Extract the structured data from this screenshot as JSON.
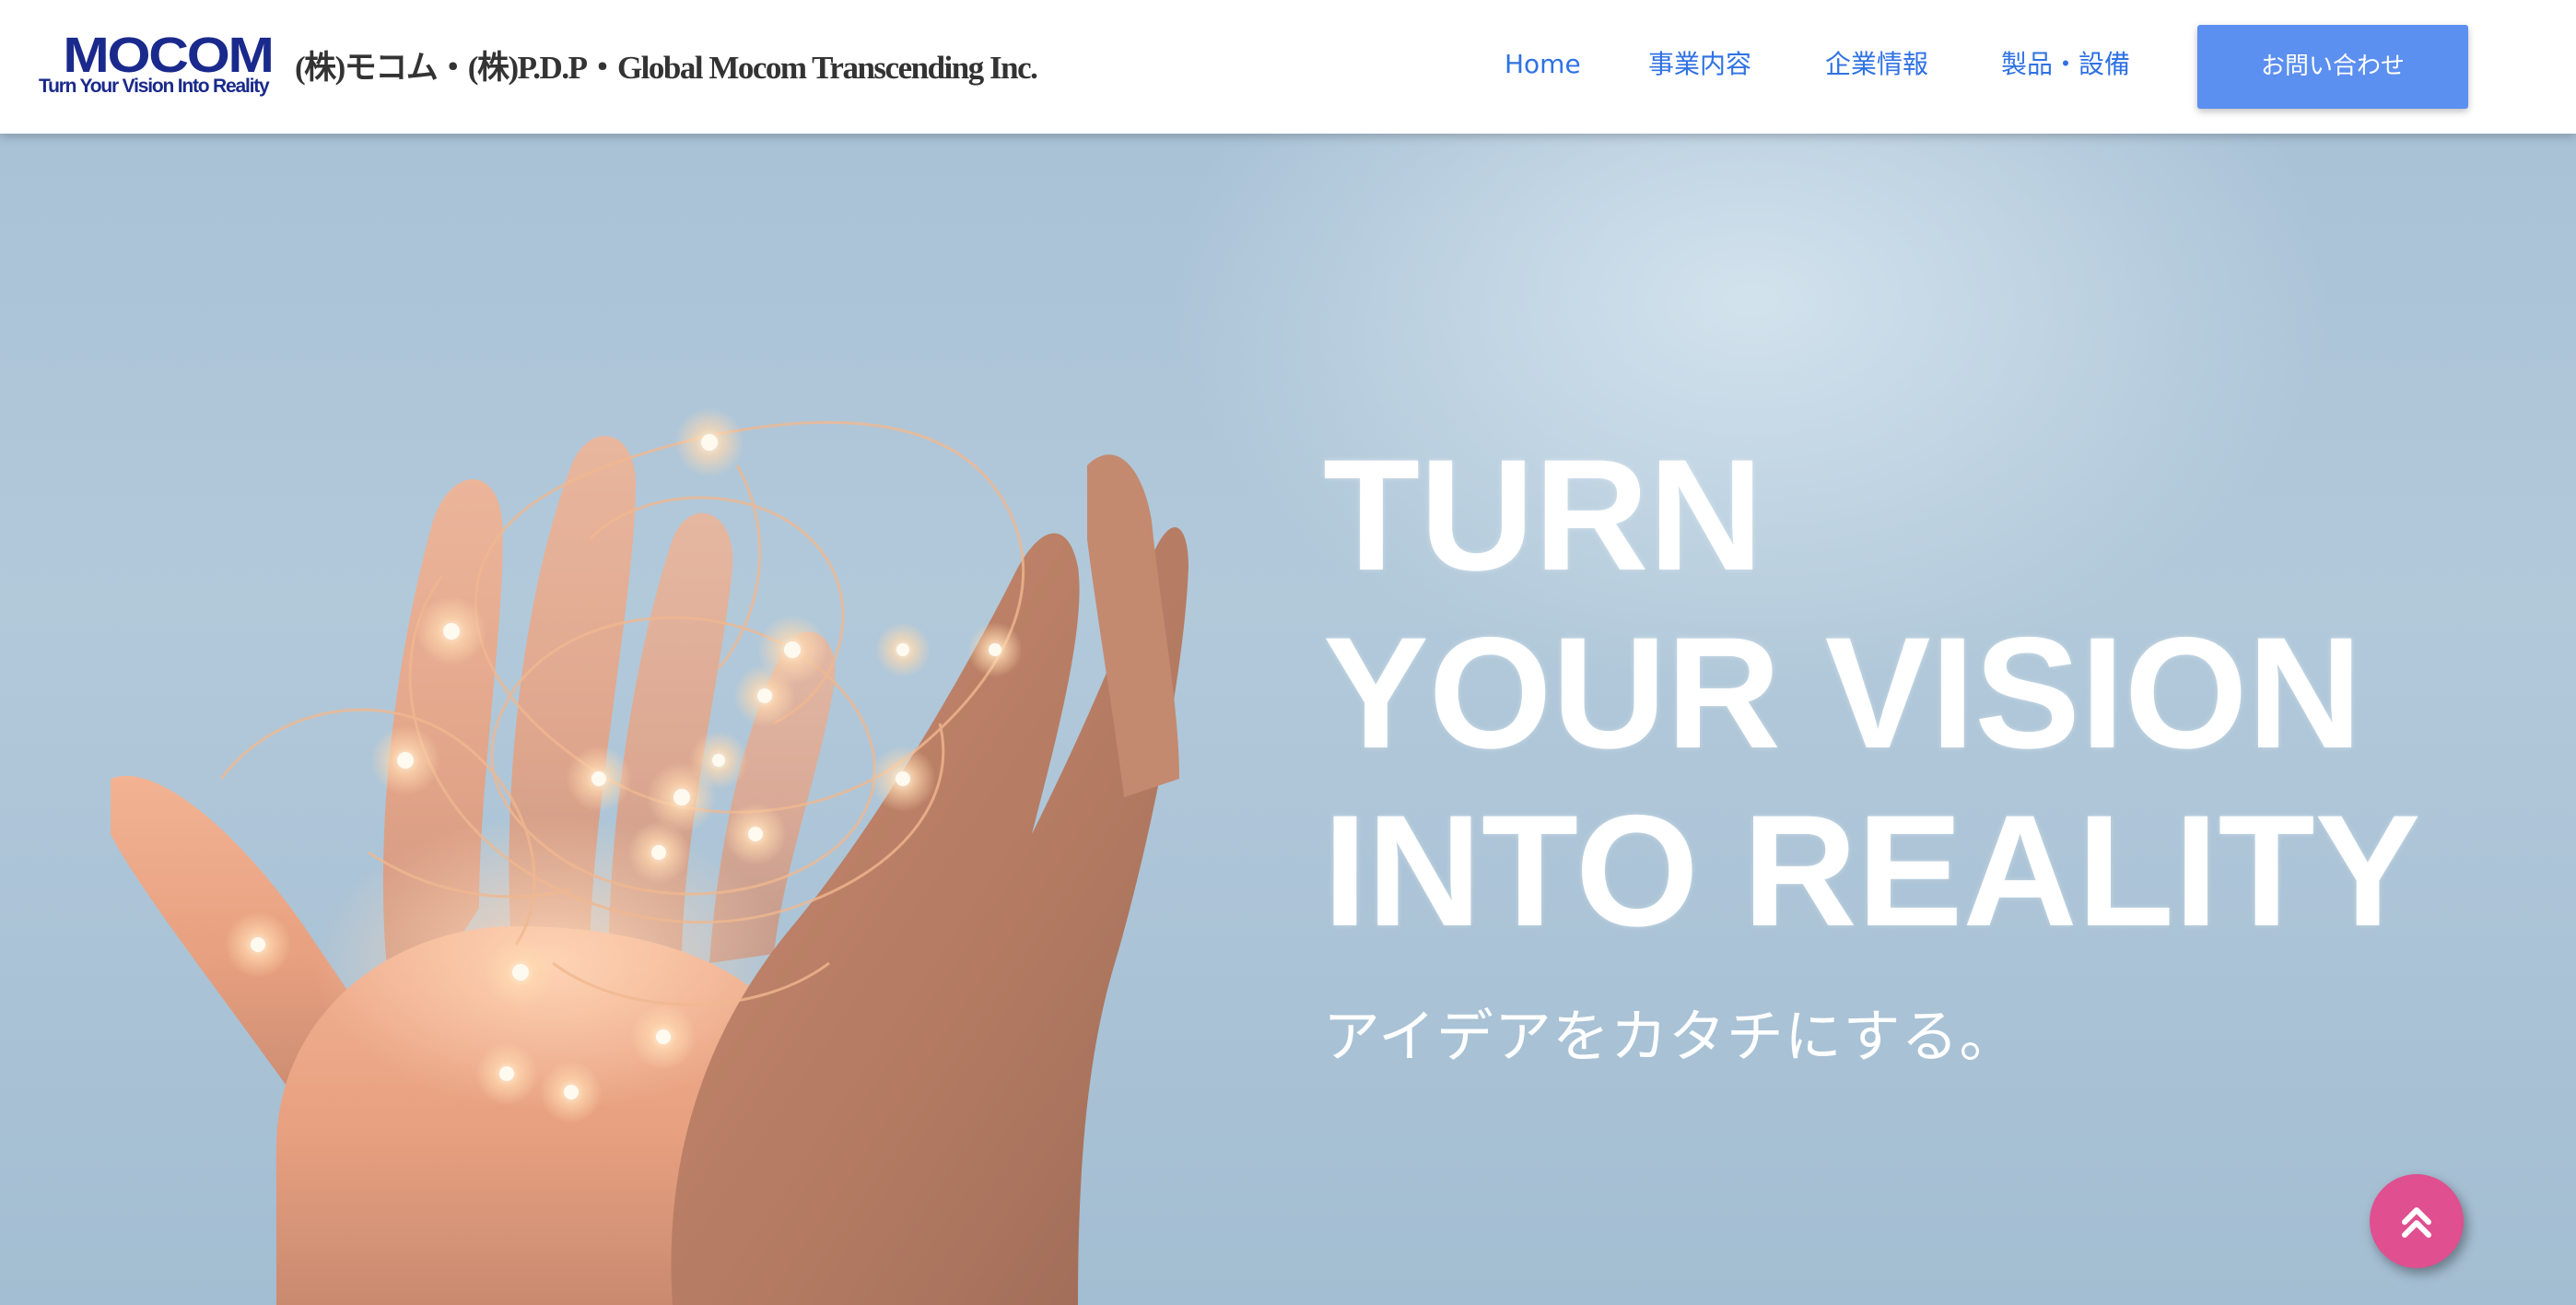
{
  "header": {
    "logo": {
      "wordmark": "MOCOM",
      "tagline": "Turn Your Vision Into Reality"
    },
    "company_name": "(株)モコム・(株)P.D.P・Global Mocom Transcending Inc.",
    "nav": [
      {
        "label": "Home"
      },
      {
        "label": "事業内容"
      },
      {
        "label": "企業情報"
      },
      {
        "label": "製品・設備"
      }
    ],
    "contact_button": "お問い合わせ"
  },
  "hero": {
    "headline": [
      "TURN",
      "YOUR VISION",
      "INTO REALITY"
    ],
    "subtitle": "アイデアをカタチにする。",
    "image_icon": "hands-holding-fairy-lights"
  },
  "scroll_top": {
    "icon": "double-chevron-up-icon"
  },
  "colors": {
    "logo": "#1a2a8c",
    "nav_link": "#2f72e4",
    "contact_button": "#5b8ff0",
    "scroll_top_button": "#e04f8f",
    "hero_sky": "#aec6d8"
  }
}
